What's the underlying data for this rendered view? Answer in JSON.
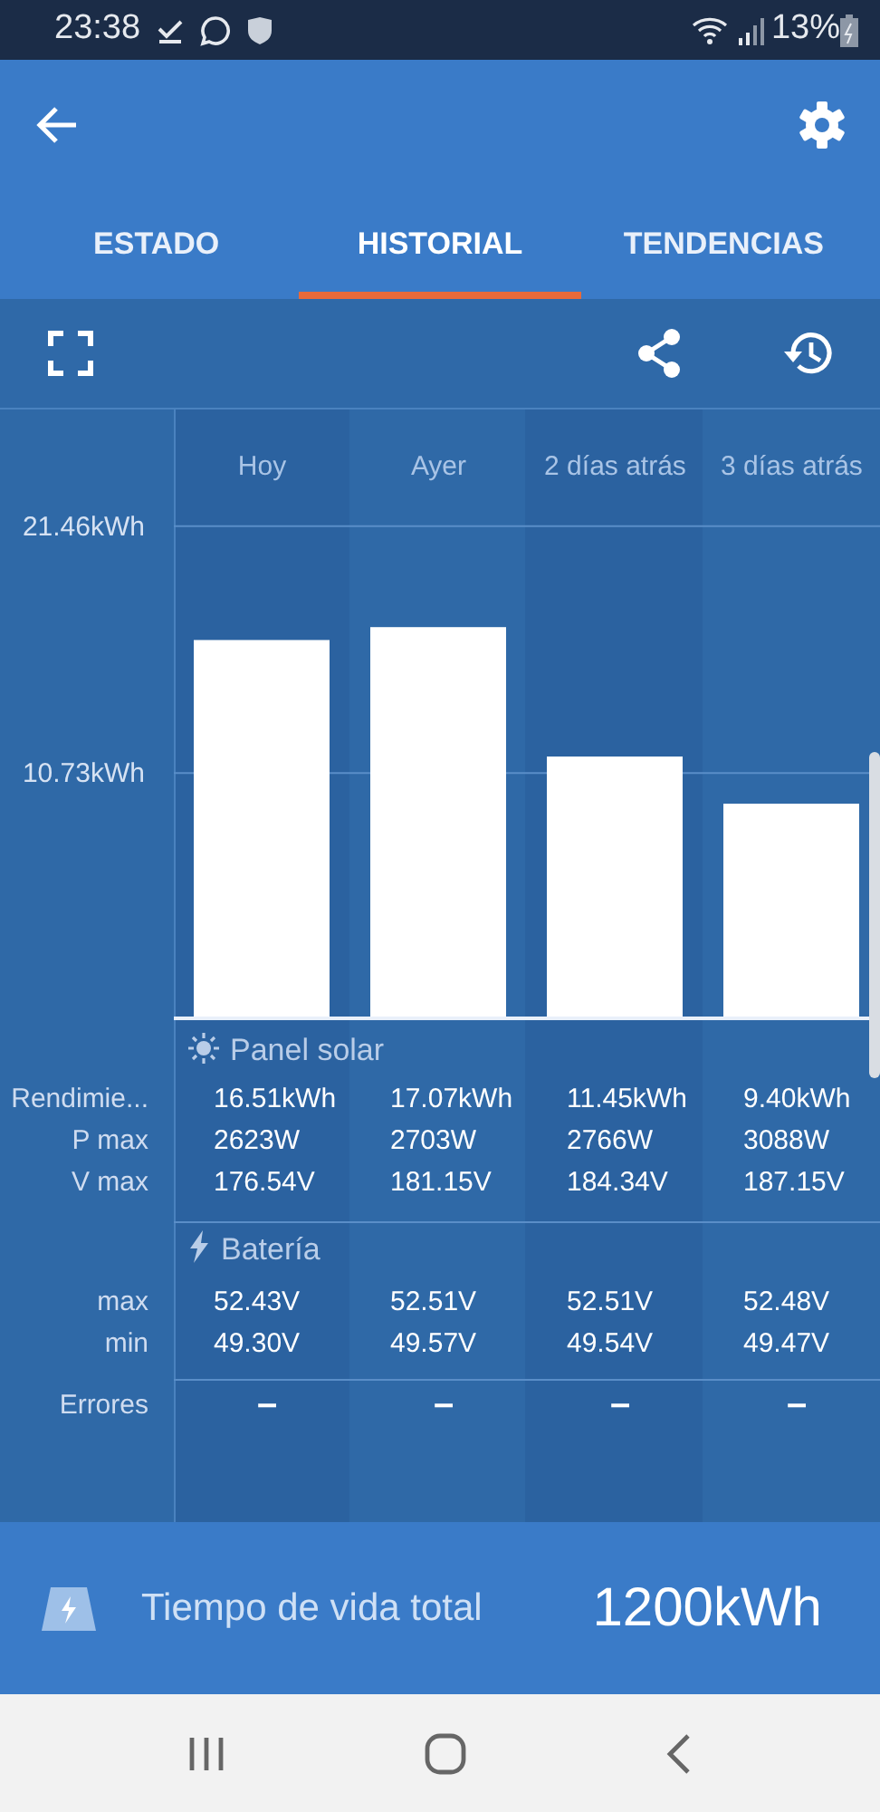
{
  "status_bar": {
    "time": "23:38",
    "battery": "13%"
  },
  "tabs": [
    {
      "label": "ESTADO",
      "selected": false
    },
    {
      "label": "HISTORIAL",
      "selected": true
    },
    {
      "label": "TENDENCIAS",
      "selected": false
    }
  ],
  "chart_data": {
    "type": "bar",
    "categories": [
      "Hoy",
      "Ayer",
      "2 días atrás",
      "3 días atrás"
    ],
    "values": [
      16.51,
      17.07,
      11.45,
      9.4
    ],
    "ylim": [
      0,
      26.6
    ],
    "yticks": [
      {
        "value": 10.73,
        "label": "10.73kWh"
      },
      {
        "value": 21.46,
        "label": "21.46kWh"
      }
    ]
  },
  "sections": [
    {
      "kind": "solar",
      "title": "Panel solar",
      "rows": [
        {
          "label": "Rendimie...",
          "values": [
            "16.51kWh",
            "17.07kWh",
            "11.45kWh",
            "9.40kWh"
          ]
        },
        {
          "label": "P max",
          "values": [
            "2623W",
            "2703W",
            "2766W",
            "3088W"
          ]
        },
        {
          "label": "V max",
          "values": [
            "176.54V",
            "181.15V",
            "184.34V",
            "187.15V"
          ]
        }
      ]
    },
    {
      "kind": "battery",
      "title": "Batería",
      "rows": [
        {
          "label": "max",
          "values": [
            "52.43V",
            "52.51V",
            "52.51V",
            "52.48V"
          ]
        },
        {
          "label": "min",
          "values": [
            "49.30V",
            "49.57V",
            "49.54V",
            "49.47V"
          ]
        }
      ]
    }
  ],
  "errors": {
    "label": "Errores",
    "values": [
      "–",
      "–",
      "–",
      "–"
    ]
  },
  "lifetime": {
    "label": "Tiempo de vida total",
    "value": "1200kWh"
  }
}
